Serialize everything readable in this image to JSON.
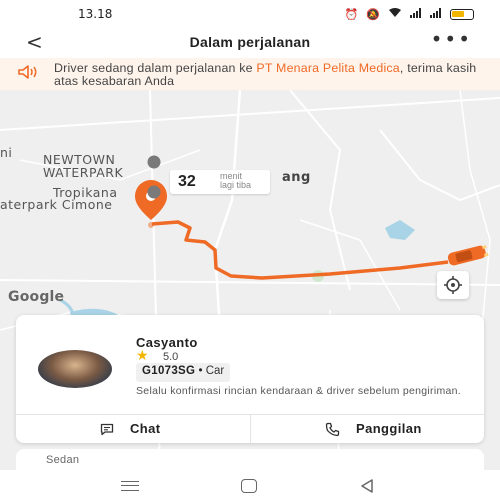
{
  "status_bar": {
    "time": "13.18",
    "icons": [
      "alarm-icon",
      "mute-icon",
      "wifi-icon",
      "signal-icon",
      "signal-icon",
      "battery-icon"
    ]
  },
  "header": {
    "title": "Dalam perjalanan",
    "back_icon": "back-arrow-icon",
    "more_icon": "more-dots-icon"
  },
  "banner": {
    "prefix": "Driver sedang dalam perjalanan ke ",
    "destination": "PT Menara Pelita Medica",
    "suffix": ", terima kasih atas kesabaran Anda",
    "icon": "speaker-icon"
  },
  "map": {
    "labels": {
      "newtown": "NEWTOWN",
      "waterpark": "WATERPARK",
      "tropikana": "Tropikana",
      "waterpark_cimone": "aterpark Cimone",
      "ang": "ang",
      "left_edge": "ni"
    },
    "eta": {
      "minutes": "32",
      "unit_line1": "menit",
      "unit_line2": "lagi tiba"
    },
    "google": "Google",
    "colors": {
      "route": "#ef6a25",
      "road": "#ffffff",
      "water": "#a9d3e6",
      "park": "#cfe8cf"
    }
  },
  "driver": {
    "name": "Casyanto",
    "rating": "5.0",
    "plate": "G1073SG",
    "separator": "•",
    "vehicle": "Car",
    "note": "Selalu konfirmasi rincian kendaraan & driver sebelum pengiriman.",
    "chat_label": "Chat",
    "call_label": "Panggilan"
  },
  "sheet": {
    "label": "Sedan"
  },
  "colors": {
    "accent": "#ef6a25",
    "star": "#f2b600"
  }
}
